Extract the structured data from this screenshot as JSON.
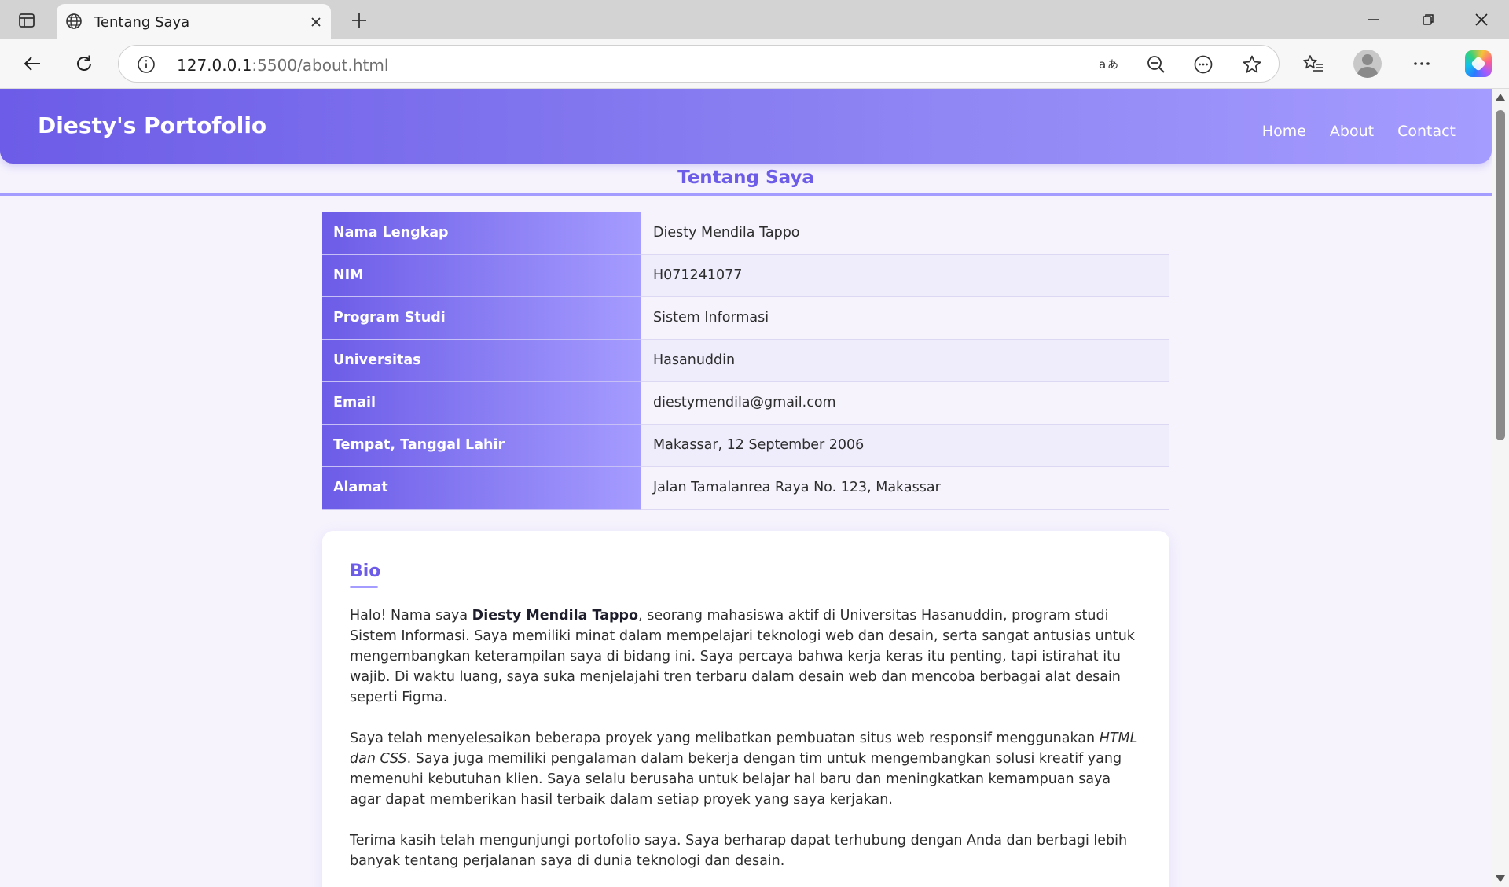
{
  "browser": {
    "tab_title": "Tentang Saya",
    "url_host": "127.0.0.1",
    "url_path": ":5500/about.html"
  },
  "site": {
    "brand": "Diesty's Portofolio",
    "nav": [
      "Home",
      "About",
      "Contact"
    ]
  },
  "page": {
    "title": "Tentang Saya"
  },
  "info": {
    "rows": [
      {
        "label": "Nama Lengkap",
        "value": "Diesty Mendila Tappo"
      },
      {
        "label": "NIM",
        "value": "H071241077"
      },
      {
        "label": "Program Studi",
        "value": "Sistem Informasi"
      },
      {
        "label": "Universitas",
        "value": "Hasanuddin"
      },
      {
        "label": "Email",
        "value": "diestymendila@gmail.com"
      },
      {
        "label": "Tempat, Tanggal Lahir",
        "value": "Makassar, 12 September 2006"
      },
      {
        "label": "Alamat",
        "value": "Jalan Tamalanrea Raya No. 123, Makassar"
      }
    ]
  },
  "bio": {
    "heading": "Bio",
    "p1_before": "Halo! Nama saya ",
    "p1_bold": "Diesty Mendila Tappo",
    "p1_after": ", seorang mahasiswa aktif di Universitas Hasanuddin, program studi Sistem Informasi. Saya memiliki minat dalam mempelajari teknologi web dan desain, serta sangat antusias untuk mengembangkan keterampilan saya di bidang ini. Saya percaya bahwa kerja keras itu penting, tapi istirahat itu wajib. Di waktu luang, saya suka menjelajahi tren terbaru dalam desain web dan mencoba berbagai alat desain seperti Figma.",
    "p2_before": "Saya telah menyelesaikan beberapa proyek yang melibatkan pembuatan situs web responsif menggunakan ",
    "p2_italic": "HTML dan CSS",
    "p2_after": ". Saya juga memiliki pengalaman dalam bekerja dengan tim untuk mengembangkan solusi kreatif yang memenuhi kebutuhan klien. Saya selalu berusaha untuk belajar hal baru dan meningkatkan kemampuan saya agar dapat memberikan hasil terbaik dalam setiap proyek yang saya kerjakan.",
    "p3": "Terima kasih telah mengunjungi portofolio saya. Saya berharap dapat terhubung dengan Anda dan berbagi lebih banyak tentang perjalanan saya di dunia teknologi dan desain."
  },
  "colors": {
    "accent": "#6c5ce7",
    "accent_light": "#a59cff",
    "page_bg": "#f6f3fd"
  },
  "icons": {
    "tab_actions": "tab-actions-icon",
    "favicon": "globe-icon",
    "close": "close-icon",
    "new_tab": "plus-icon",
    "back": "back-arrow-icon",
    "reload": "reload-icon",
    "site_info": "info-icon",
    "read_aloud": "read-aloud-icon",
    "zoom_out": "zoom-out-icon",
    "more_page": "ellipsis-circle-icon",
    "favorite": "star-icon",
    "favorites_list": "favorites-icon",
    "profile": "avatar-icon",
    "settings_more": "ellipsis-icon",
    "copilot": "copilot-icon"
  }
}
